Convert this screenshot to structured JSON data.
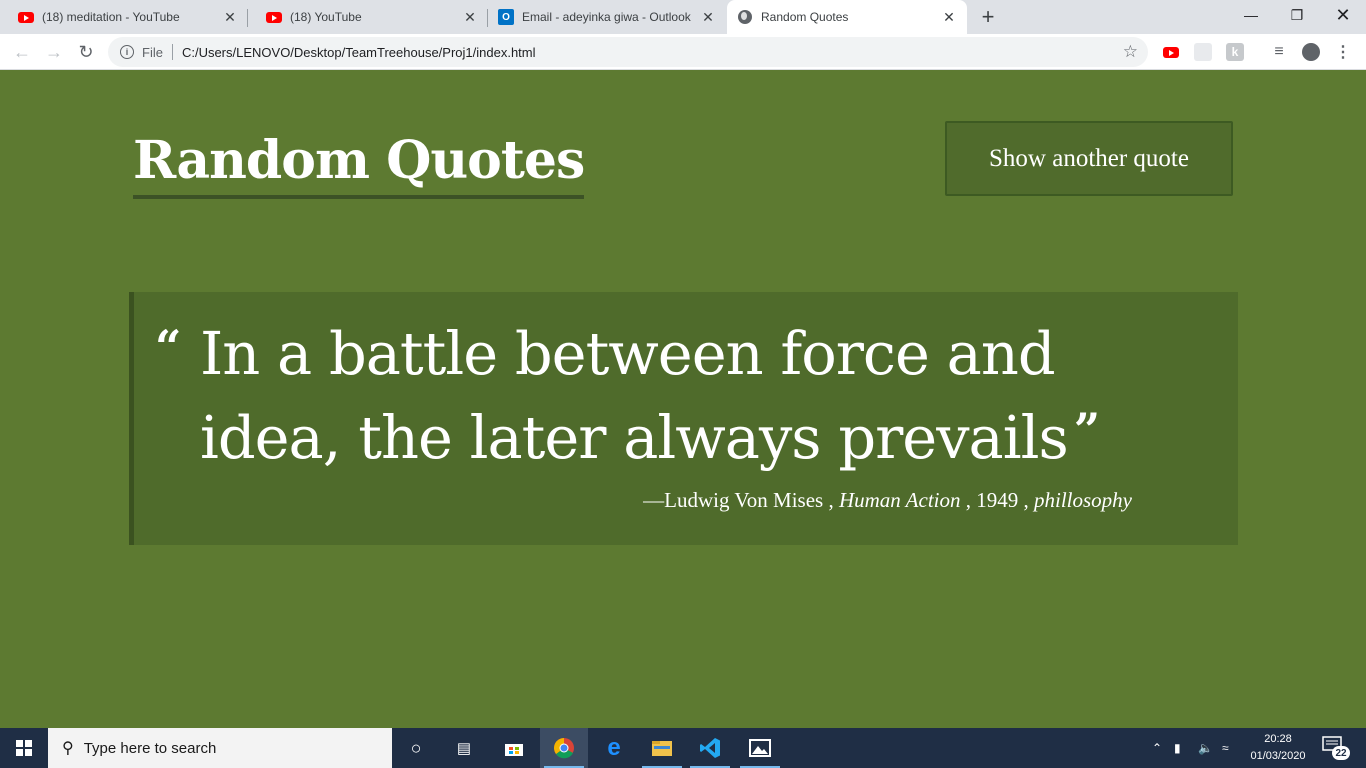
{
  "browser": {
    "tabs": [
      {
        "title": "(18) meditation - YouTube",
        "icon": "youtube-icon",
        "active": false
      },
      {
        "title": "(18) YouTube",
        "icon": "youtube-icon",
        "active": false
      },
      {
        "title": "Email - adeyinka giwa - Outlook",
        "icon": "outlook-icon",
        "active": false
      },
      {
        "title": "Random Quotes",
        "icon": "globe-icon",
        "active": true
      }
    ],
    "address": {
      "scheme_label": "File",
      "url": "C:/Users/LENOVO/Desktop/TeamTreehouse/Proj1/index.html"
    }
  },
  "page": {
    "heading": "Random Quotes",
    "button_label": "Show another quote",
    "quote": {
      "text": "In a battle between force and idea, the later always prevails",
      "open_mark": "“",
      "close_mark": "”",
      "source": "—Ludwig Von Mises",
      "citation": "Human Action",
      "year": "1949",
      "tag": "phillosophy",
      "separator": " , "
    },
    "colors": {
      "background": "#5d7a31",
      "quote_box": "#4f6b2b",
      "accent_border": "#3b5220",
      "text": "#ffffff"
    }
  },
  "taskbar": {
    "search_placeholder": "Type here to search",
    "time": "20:28",
    "date": "01/03/2020",
    "notification_count": "22"
  }
}
